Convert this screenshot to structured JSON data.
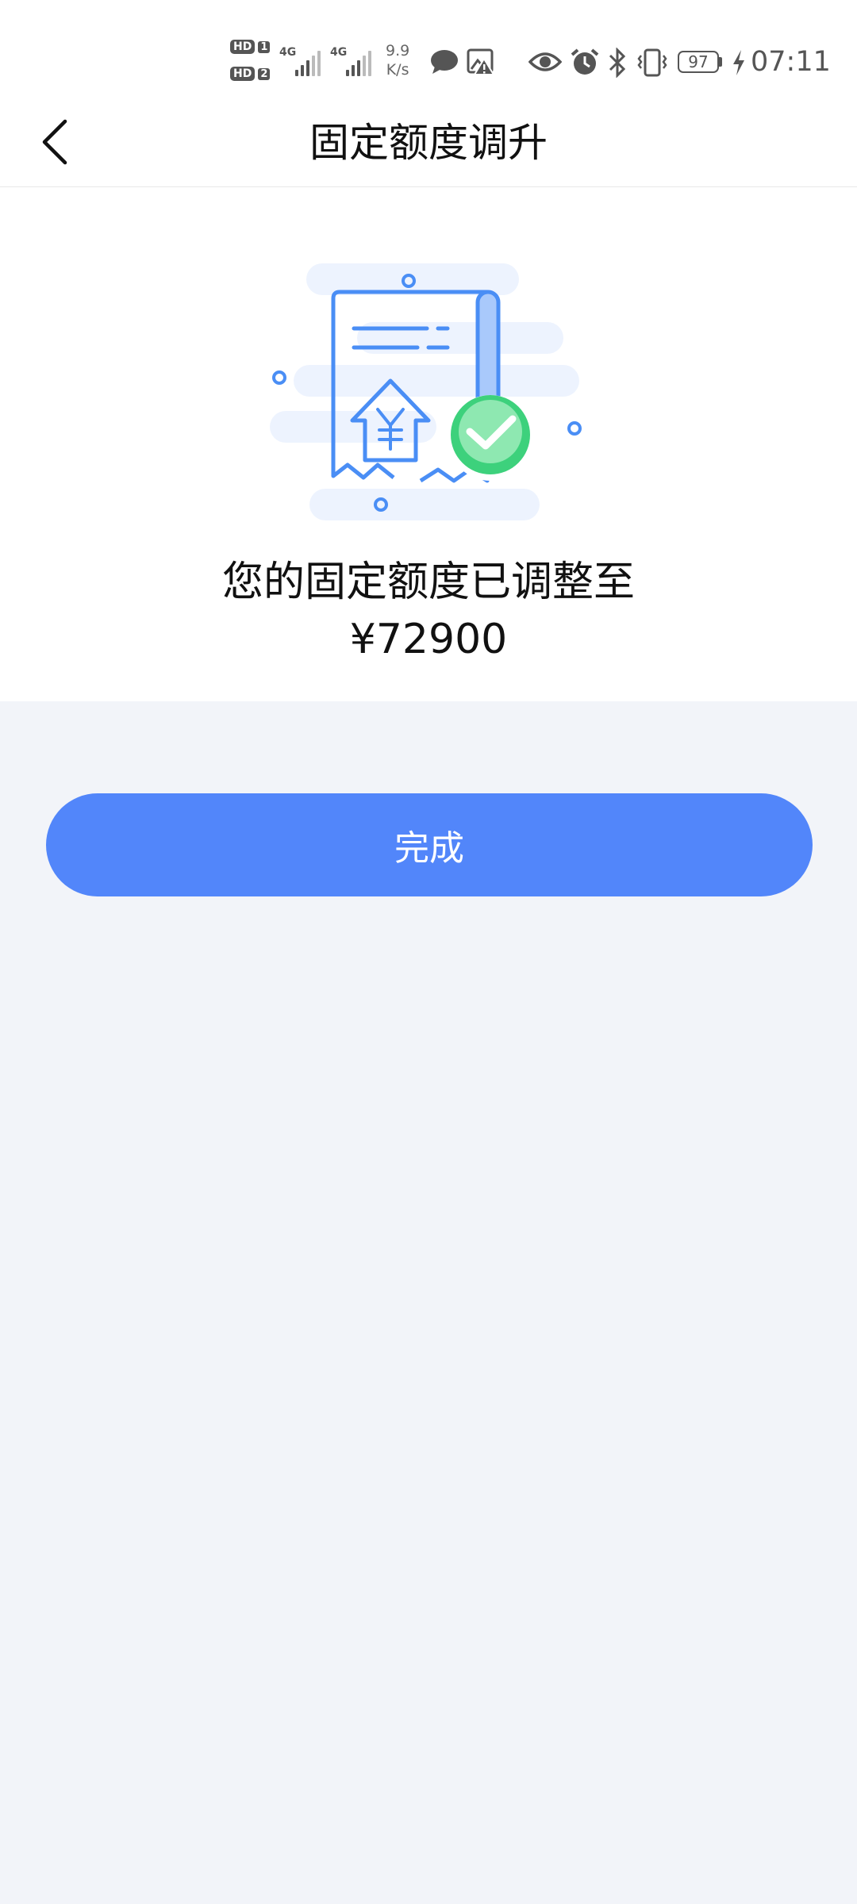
{
  "status_bar": {
    "sim1_hd": "HD",
    "sim1_num": "1",
    "sim2_hd": "HD",
    "sim2_num": "2",
    "sim1_network": "4G",
    "sim2_network": "4G",
    "net_speed_value": "9.9",
    "net_speed_unit": "K/s",
    "battery_level": "97",
    "time": "07:11",
    "icons": [
      "message-icon",
      "image-warning-icon",
      "eye-icon",
      "alarm-icon",
      "bluetooth-icon",
      "vibrate-icon",
      "battery-icon",
      "charging-icon"
    ]
  },
  "nav": {
    "back_icon": "chevron-left-icon",
    "title": "固定额度调升"
  },
  "result": {
    "illustration": "receipt-success-illustration",
    "message": "您的固定额度已调整至",
    "amount": "¥72900"
  },
  "actions": {
    "done_label": "完成"
  },
  "colors": {
    "primary": "#5286fa",
    "success": "#3dd17c",
    "illustration_blue": "#4a8ef5",
    "page_background": "#f2f4f9"
  }
}
